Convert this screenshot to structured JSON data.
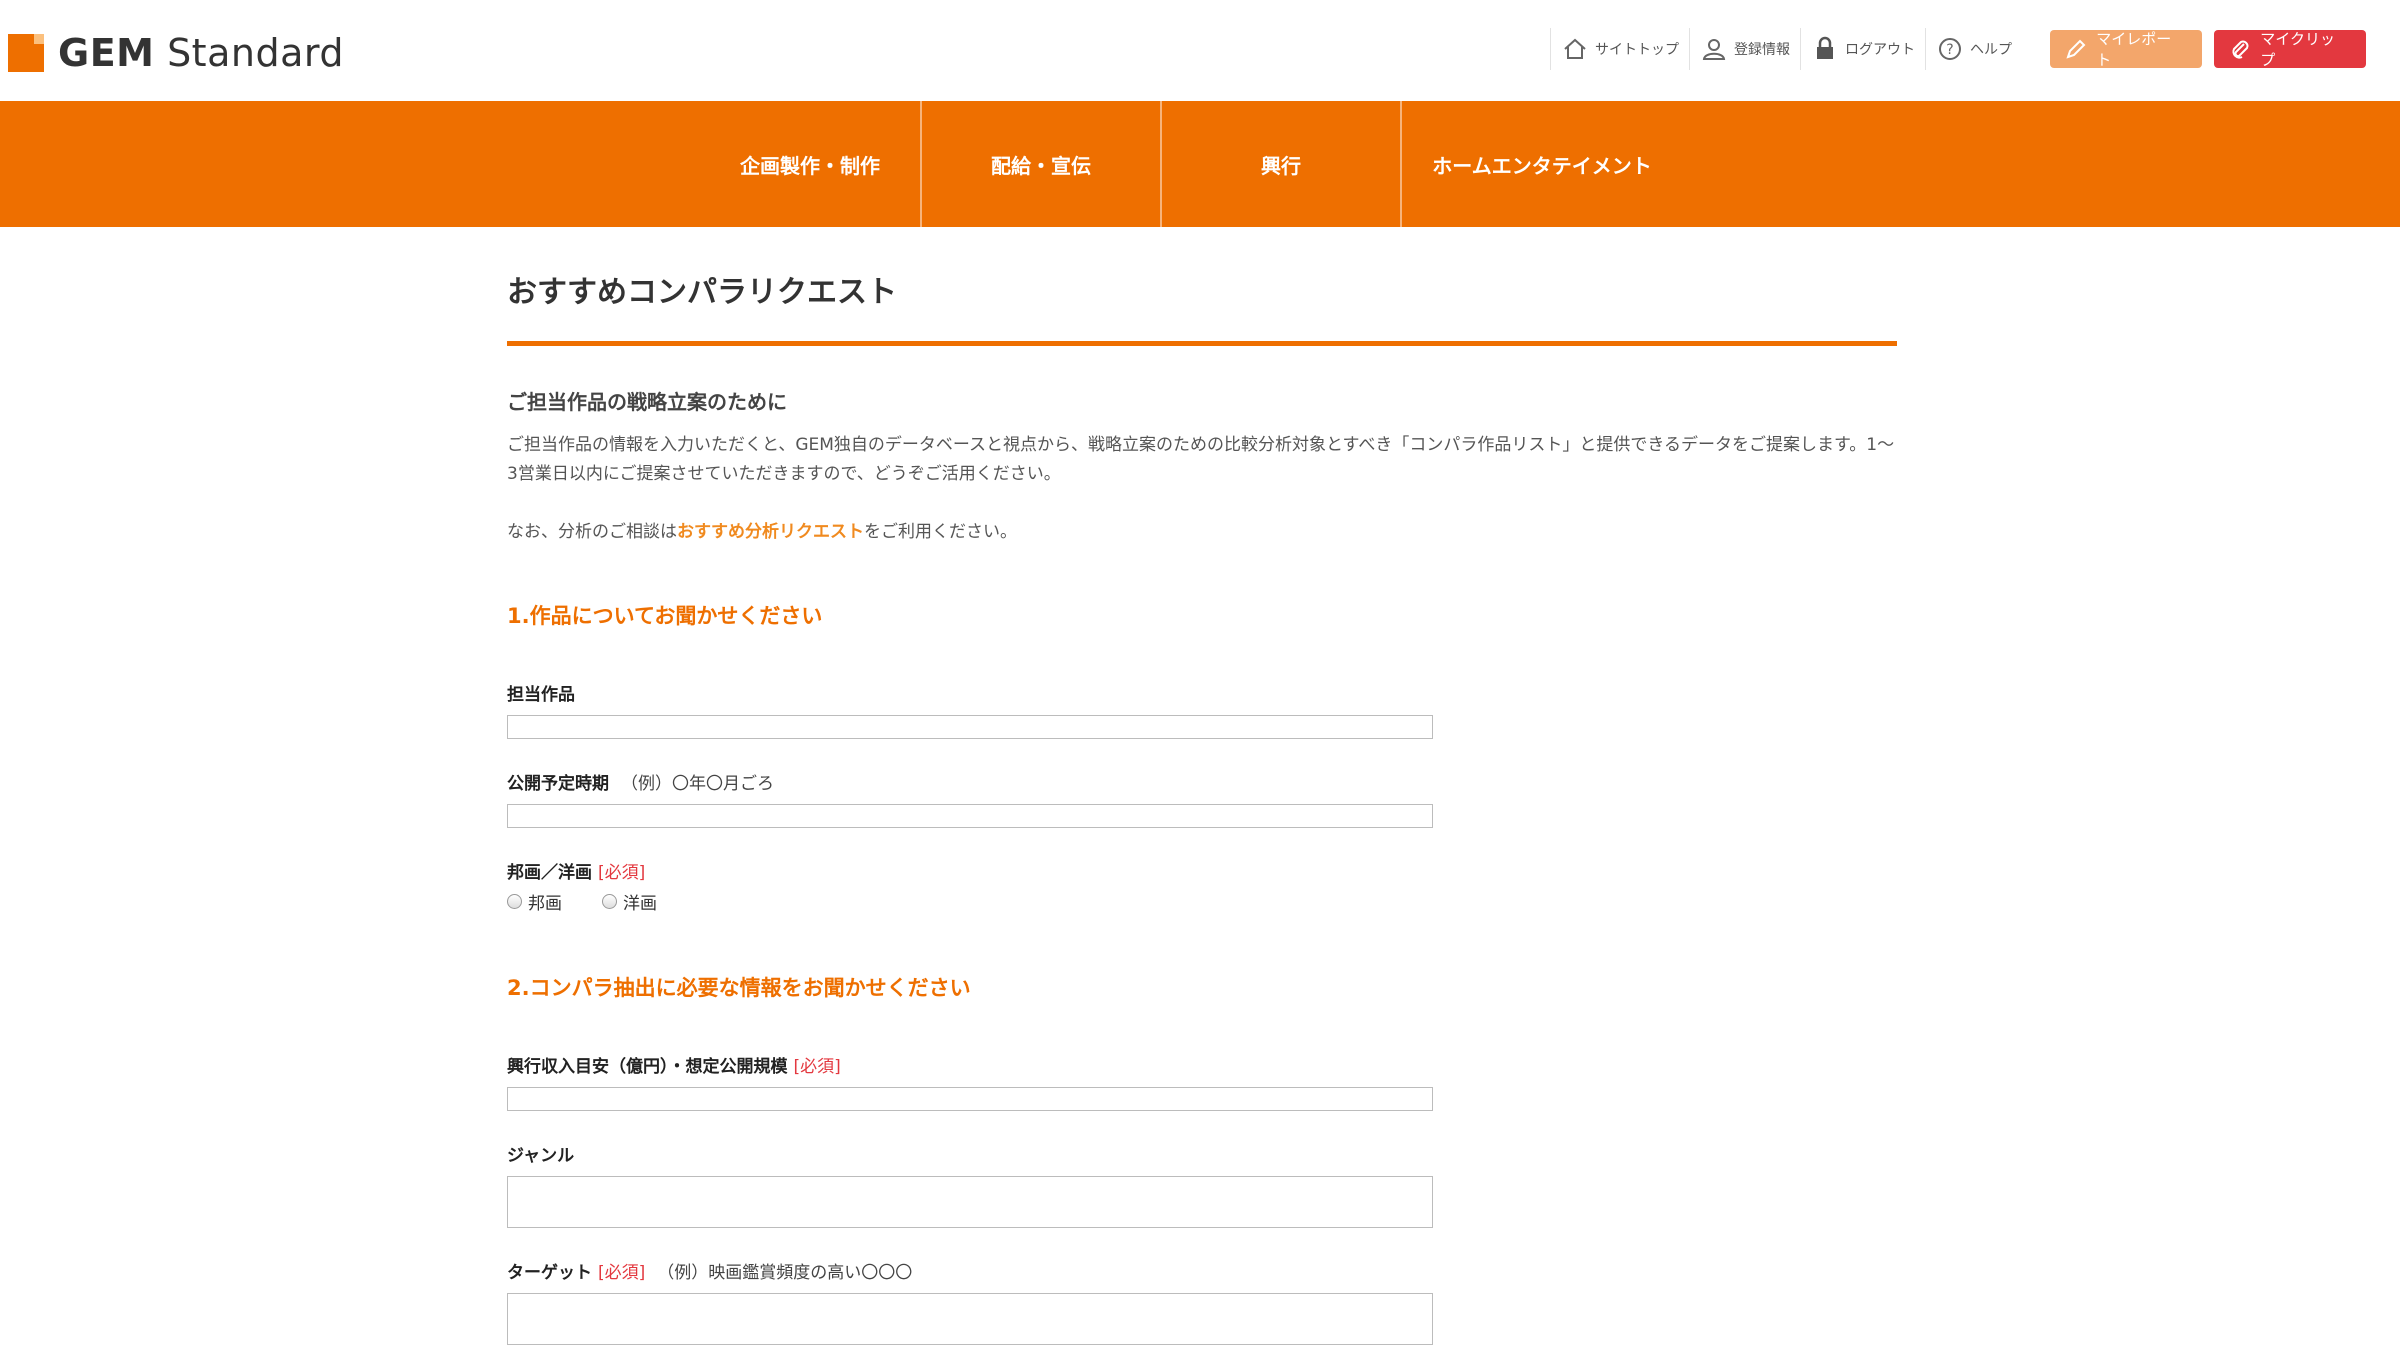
{
  "header": {
    "logo_bold": "GEM",
    "logo_light": "Standard",
    "util": [
      {
        "label": "サイトトップ",
        "icon": "home-icon"
      },
      {
        "label": "登録情報",
        "icon": "user-icon"
      },
      {
        "label": "ログアウト",
        "icon": "lock-icon"
      },
      {
        "label": "ヘルプ",
        "icon": "help-icon"
      }
    ],
    "my_report": "マイレポート",
    "my_clip": "マイクリップ",
    "colors": {
      "brand": "#ee6f00",
      "report": "#f3a66b",
      "clip": "#e3383f"
    }
  },
  "nav": {
    "items": [
      "企画製作・制作",
      "配給・宣伝",
      "興行",
      "ホームエンタテイメント"
    ]
  },
  "page": {
    "title": "おすすめコンパラリクエスト",
    "intro_heading": "ご担当作品の戦略立案のために",
    "intro_text": "ご担当作品の情報を入力いただくと、GEM独自のデータベースと視点から、戦略立案のための比較分析対象とすべき「コンパラ作品リスト」と提供できるデータをご提案します。1〜3営業日以内にご提案させていただきますので、どうぞご活用ください。",
    "note_prefix": "なお、分析のご相談は",
    "note_link": "おすすめ分析リクエスト",
    "note_suffix": "をご利用ください。"
  },
  "form": {
    "section1": "1.作品についてお聞かせください",
    "title_label": "担当作品",
    "release_label": "公開予定時期",
    "release_hint": "（例）〇年〇月ごろ",
    "origin_label": "邦画／洋画",
    "required": "[必須]",
    "origin_options": [
      "邦画",
      "洋画"
    ],
    "section2": "2.コンパラ抽出に必要な情報をお聞かせください",
    "boxoffice_label": "興行収入目安（億円）・想定公開規模",
    "genre_label": "ジャンル",
    "target_label": "ターゲット",
    "target_hint": "（例）映画鑑賞頻度の高い〇〇〇"
  }
}
